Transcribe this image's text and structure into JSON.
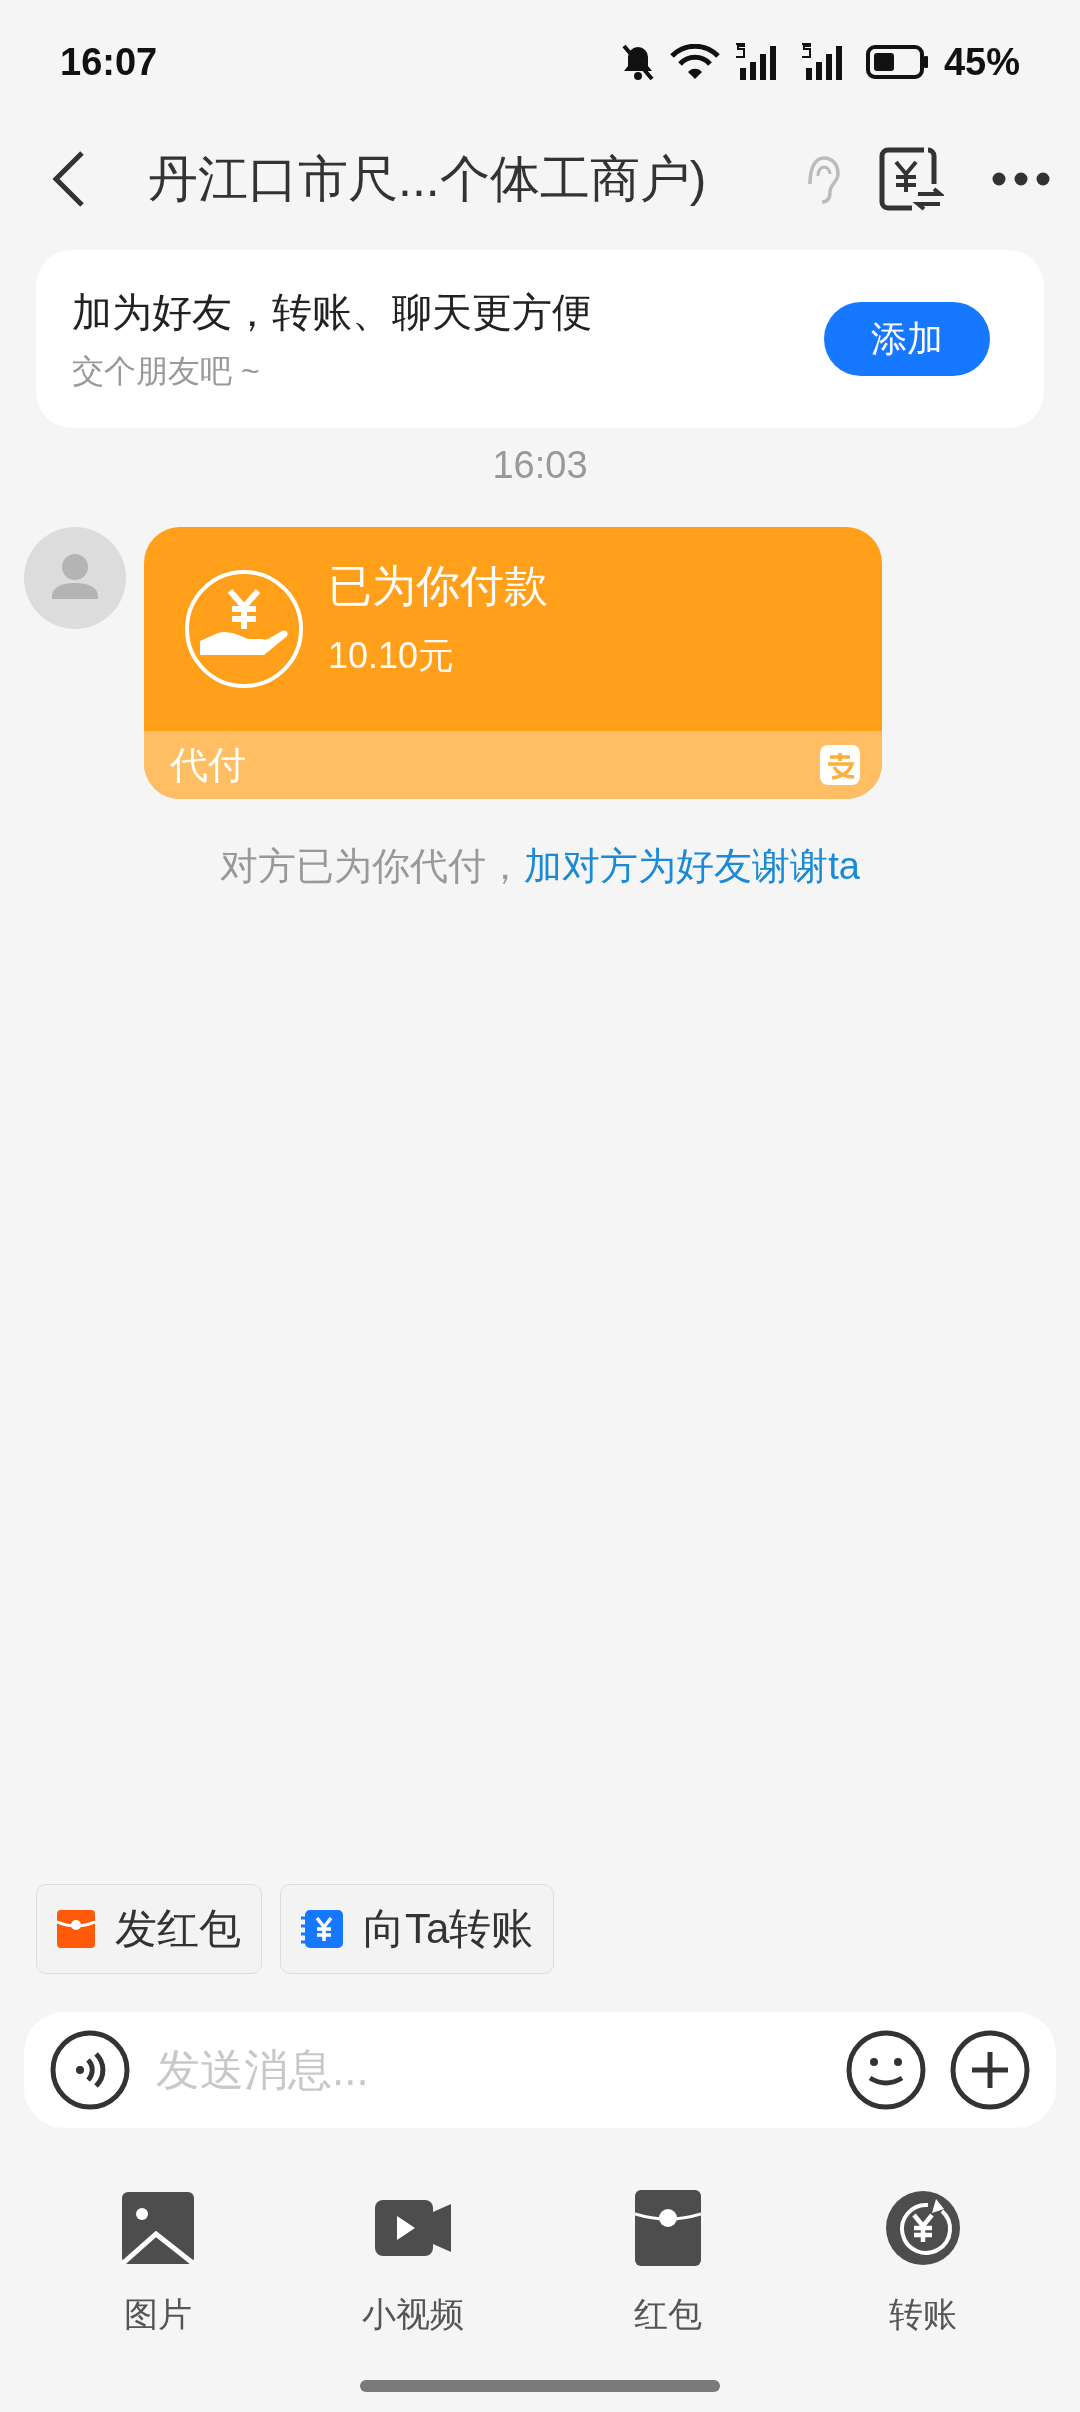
{
  "status_bar": {
    "time": "16:07",
    "battery": "45%"
  },
  "header": {
    "title": "丹江口市尺...个体工商户)"
  },
  "friend_prompt": {
    "title": "加为好友，转账、聊天更方便",
    "subtitle": "交个朋友吧 ~",
    "button": "添加"
  },
  "timestamp": "16:03",
  "payment_card": {
    "title": "已为你付款",
    "amount": "10.10元",
    "footer": "代付"
  },
  "note": {
    "text": "对方已为你代付，",
    "link": "加对方为好友谢谢ta"
  },
  "quick_actions": [
    {
      "label": "发红包",
      "kind": "red_packet"
    },
    {
      "label": "向Ta转账",
      "kind": "transfer"
    }
  ],
  "input": {
    "placeholder": "发送消息..."
  },
  "toolbar": [
    {
      "label": "图片",
      "kind": "image"
    },
    {
      "label": "小视频",
      "kind": "video"
    },
    {
      "label": "红包",
      "kind": "red_packet"
    },
    {
      "label": "转账",
      "kind": "transfer"
    }
  ]
}
